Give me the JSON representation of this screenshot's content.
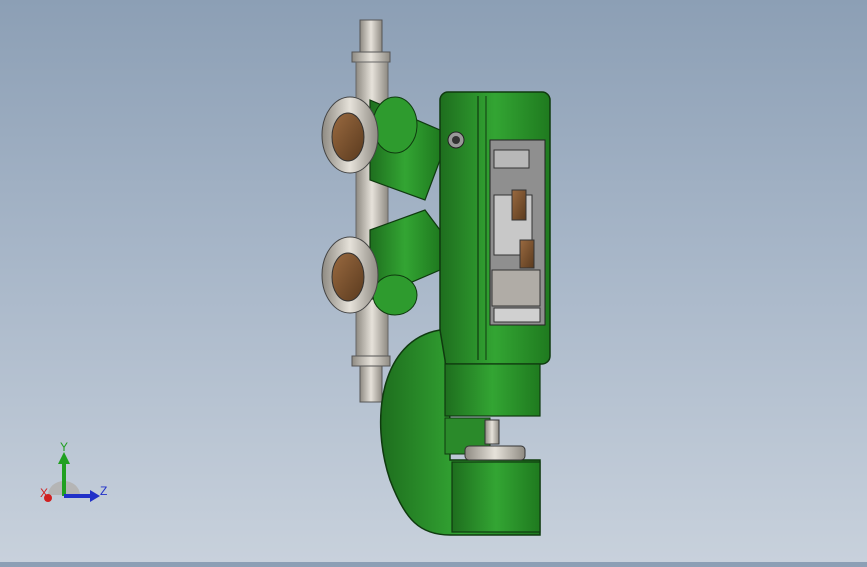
{
  "viewport": {
    "background_top": "#8c9fb5",
    "background_bottom": "#c8d1dc",
    "model_color": "#2e9b2e",
    "model_dark": "#1f6d1f",
    "metal_color": "#c8c4bc"
  },
  "triad": {
    "x_label": "X",
    "y_label": "Y",
    "z_label": "Z",
    "x_color": "#d02020",
    "y_color": "#20a020",
    "z_color": "#2030c8"
  }
}
